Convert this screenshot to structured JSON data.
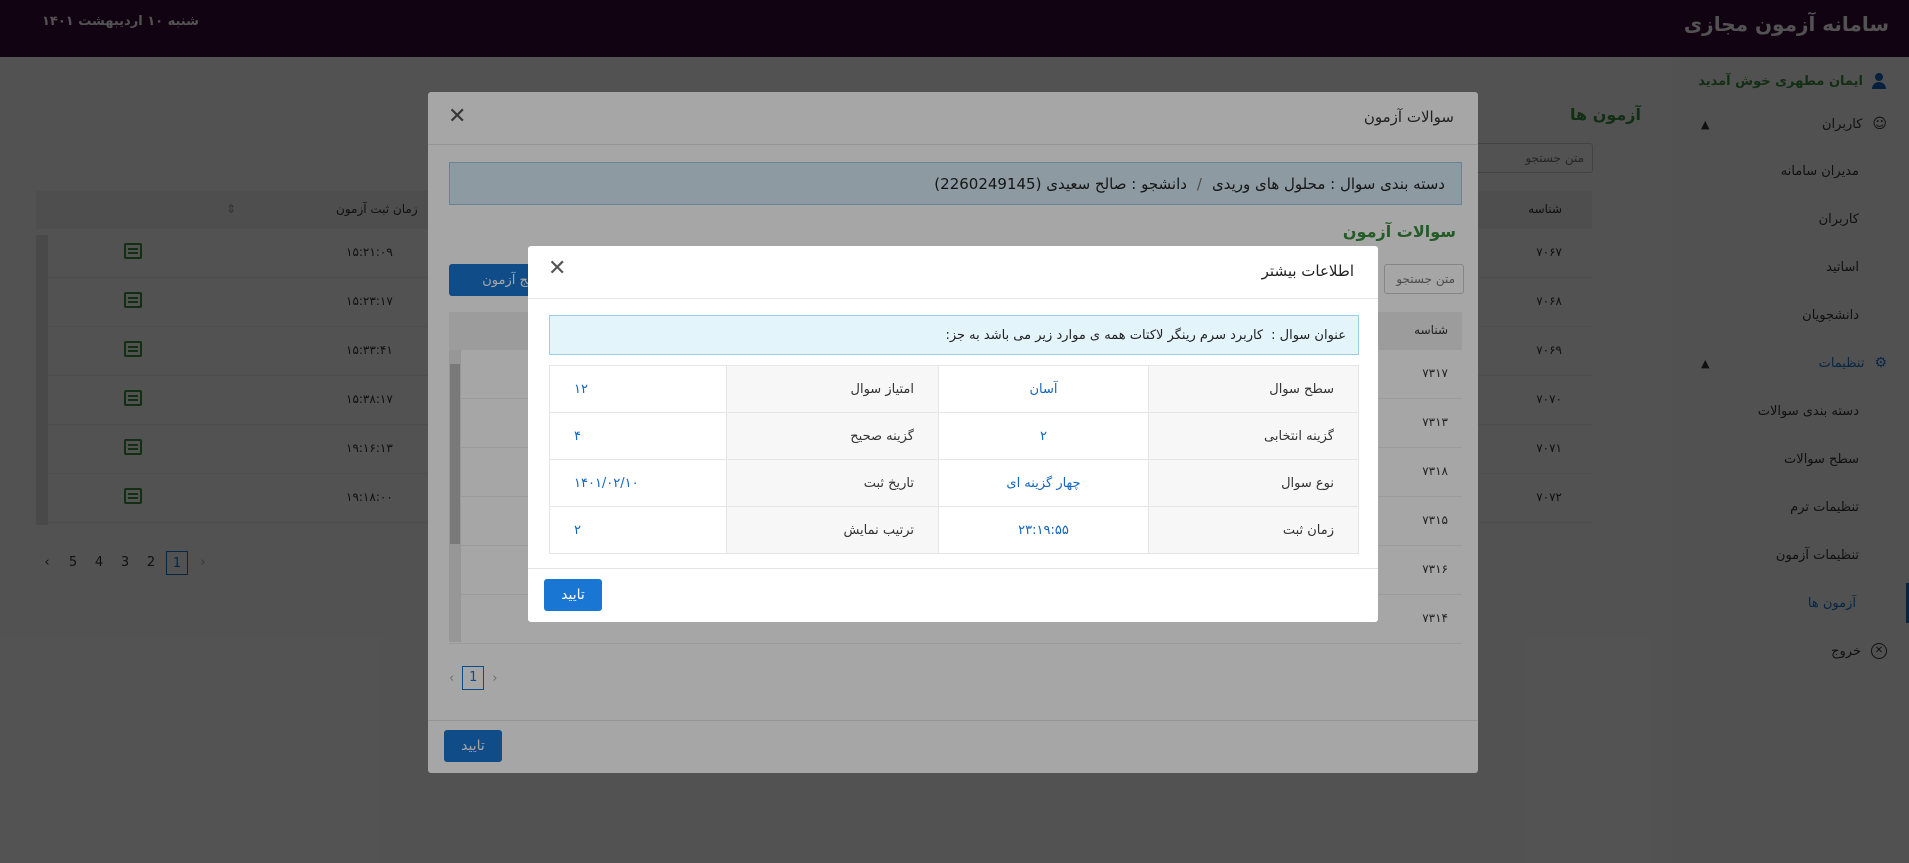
{
  "header": {
    "app_title": "سامانه آزمون مجازی",
    "date": "شنبه ۱۰ اردیبهشت ۱۴۰۱"
  },
  "sidebar": {
    "welcome": "ایمان مطهری خوش آمدید",
    "groups": [
      {
        "label": "کاربران",
        "items": [
          "مدیران سامانه",
          "کاربران",
          "اساتید",
          "دانشجویان"
        ]
      },
      {
        "label": "تنظیمات",
        "items": [
          "دسته بندی سوالات",
          "سطح سوالات",
          "تنظیمات ترم",
          "تنظیمات آزمون",
          "آزمون ها"
        ]
      }
    ],
    "logout": "خروج",
    "active_item": "آزمون ها"
  },
  "page": {
    "title": "آزمون ها",
    "search_placeholder": "متن جستجو",
    "columns": {
      "id": "شناسه",
      "time": "زمان ثبت آزمون"
    },
    "rows": [
      {
        "id": "۷۰۶۷",
        "time": "۱۵:۲۱:۰۹"
      },
      {
        "id": "۷۰۶۸",
        "time": "۱۵:۲۳:۱۷"
      },
      {
        "id": "۷۰۶۹",
        "time": "۱۵:۳۳:۴۱"
      },
      {
        "id": "۷۰۷۰",
        "time": "۱۵:۳۸:۱۷"
      },
      {
        "id": "۷۰۷۱",
        "time": "۱۹:۱۶:۱۳"
      },
      {
        "id": "۷۰۷۲",
        "time": "۱۹:۱۸:۰۰"
      }
    ],
    "pager": [
      "1",
      "2",
      "3",
      "4",
      "5"
    ],
    "current_page": "1"
  },
  "modal1": {
    "title": "سوالات آزمون",
    "category_label": "دسته بندی سوال : محلول های وریدی",
    "student_label": "دانشجو : صالح سعیدی (2260249145)",
    "section_title": "سوالات آزمون",
    "search_placeholder": "متن جستجو",
    "results_button": "نتایج آزمون",
    "id_header": "شناسه",
    "rows": [
      {
        "id": "۷۳۱۷"
      },
      {
        "id": "۷۳۱۳"
      },
      {
        "id": "۷۳۱۸"
      },
      {
        "id": "۷۳۱۵"
      },
      {
        "id": "۷۳۱۶"
      },
      {
        "id": "۷۳۱۴",
        "text": "... ... ..."
      }
    ],
    "current_page": "1",
    "ok_button": "تایید"
  },
  "modal2": {
    "title": "اطلاعات بیشتر",
    "question_label": "عنوان سوال :",
    "question_text": "کاربرد سرم رینگر لاکتات همه ی موارد زیر می باشد به جز:",
    "fields": [
      {
        "label": "سطح سوال",
        "value": "آسان",
        "label2": "امتیاز سوال",
        "value2": "۱۲"
      },
      {
        "label": "گزینه انتخابی",
        "value": "۲",
        "label2": "گزینه صحیح",
        "value2": "۴"
      },
      {
        "label": "نوع سوال",
        "value": "چهار گزینه ای",
        "label2": "تاریخ ثبت",
        "value2": "۱۴۰۱/۰۲/۱۰"
      },
      {
        "label": "زمان ثبت",
        "value": "۲۳:۱۹:۵۵",
        "label2": "ترتیب نمایش",
        "value2": "۲"
      }
    ],
    "ok_button": "تایید"
  }
}
